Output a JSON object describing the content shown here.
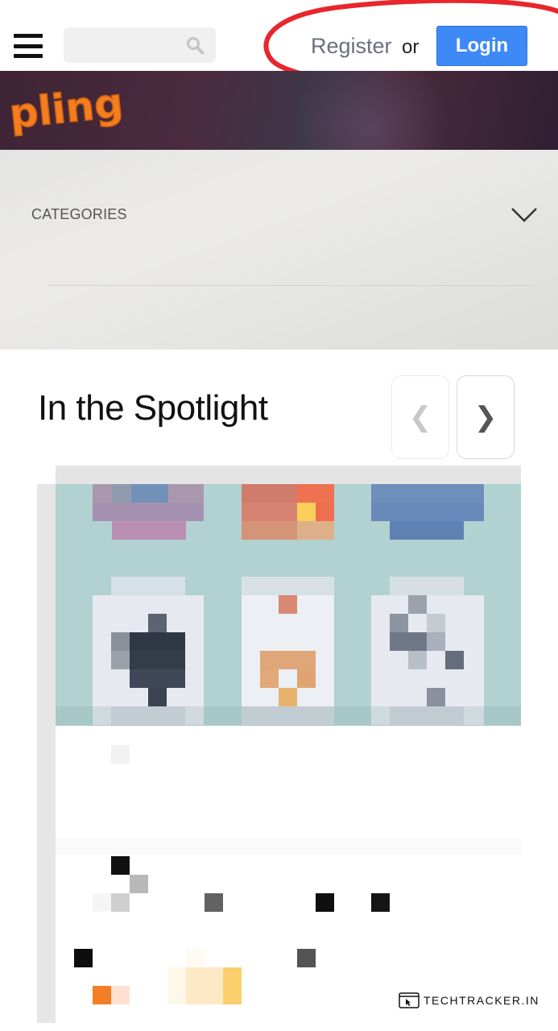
{
  "header": {
    "menu_icon": "hamburger-menu-icon",
    "search": {
      "placeholder": "",
      "icon": "search-icon"
    },
    "register_label": "Register",
    "or_label": "or",
    "login_label": "Login",
    "login_color": "#3d8af7"
  },
  "banner": {
    "logo_text": "pling",
    "logo_color": "#f47e20"
  },
  "categories": {
    "label": "CATEGORIES",
    "toggle_icon": "chevron-down-icon"
  },
  "spotlight": {
    "title": "In the Spotlight",
    "prev_label": "❮",
    "next_label": "❯"
  },
  "watermark": {
    "text": "TECHTRACKER.IN",
    "icon": "browser-cursor-icon"
  },
  "annotation_color": "#e8262b"
}
